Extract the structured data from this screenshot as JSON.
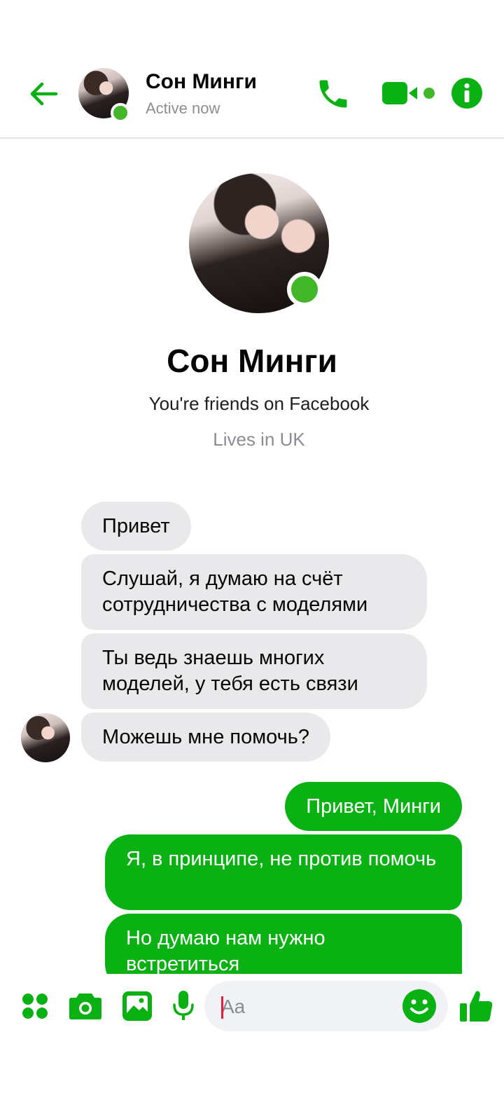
{
  "header": {
    "back_icon": "arrow-left-icon",
    "contact_name": "Сон Минги",
    "status": "Active now",
    "icons": [
      "phone-icon",
      "video-camera-icon",
      "info-icon"
    ]
  },
  "profile": {
    "name": "Сон Минги",
    "relation": "You're friends on Facebook",
    "location": "Lives in UK"
  },
  "messages": {
    "incoming": [
      "Привет",
      "Слушай, я думаю на счёт сотрудничества с моделями",
      "Ты ведь знаешь многих моделей, у тебя есть связи",
      "Можешь мне помочь?"
    ],
    "outgoing": [
      "Привет, Минги",
      "Я, в принципе, не против помочь",
      "Но думаю нам нужно встретиться"
    ]
  },
  "composer": {
    "placeholder": "Aa",
    "icons": [
      "apps-grid-icon",
      "camera-icon",
      "image-icon",
      "microphone-icon",
      "emoji-icon",
      "thumbs-up-icon"
    ]
  },
  "colors": {
    "accent": "#09b212",
    "online": "#42b72a",
    "incoming_bubble": "#e9e9eb",
    "muted_text": "#8a8d91"
  }
}
